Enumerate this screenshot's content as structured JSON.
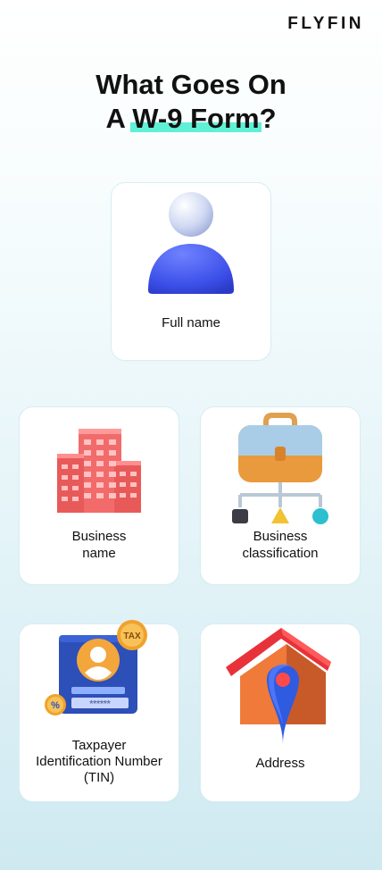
{
  "brand": "FLYFIN",
  "title": {
    "line1": "What Goes On",
    "line2_prefix": "A ",
    "line2_highlight": "W-9 Form",
    "line2_suffix": "?"
  },
  "colors": {
    "highlight": "#5ff0d6",
    "card_border": "#d8eef3"
  },
  "cards": [
    {
      "label_line1": "Full name",
      "label_line2": "",
      "label_line3": "",
      "icon": "person-icon"
    },
    {
      "label_line1": "Business",
      "label_line2": "name",
      "label_line3": "",
      "icon": "office-building-icon"
    },
    {
      "label_line1": "Business",
      "label_line2": "classification",
      "label_line3": "",
      "icon": "briefcase-hierarchy-icon"
    },
    {
      "label_line1": "Taxpayer",
      "label_line2": "Identification Number",
      "label_line3": "(TIN)",
      "icon": "tax-id-card-icon"
    },
    {
      "label_line1": "Address",
      "label_line2": "",
      "label_line3": "",
      "icon": "house-location-pin-icon"
    }
  ],
  "tin_icon": {
    "badge_text": "TAX",
    "percent": "%",
    "masked_number": "******"
  }
}
